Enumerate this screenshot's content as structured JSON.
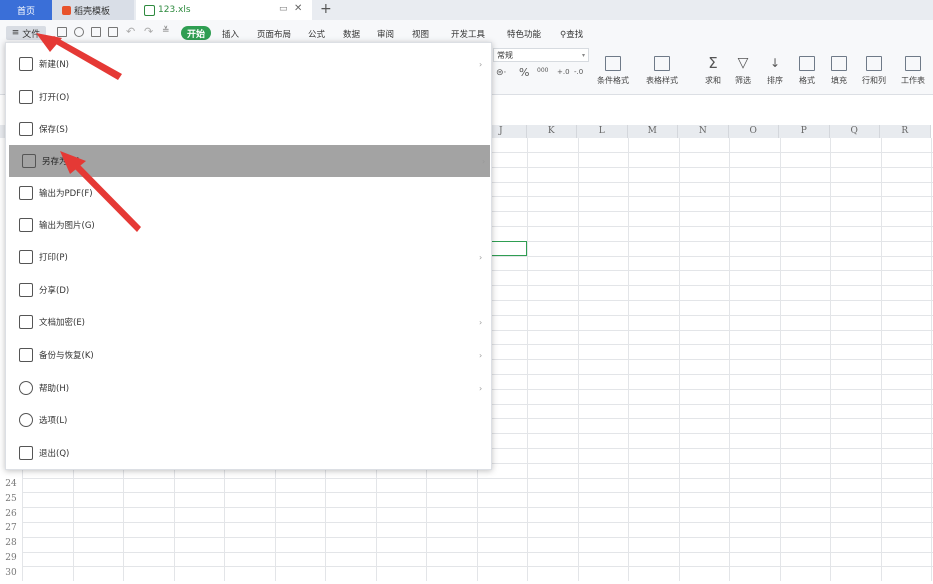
{
  "tabs": {
    "home": "首页",
    "template": "稻壳模板",
    "file": "123.xls"
  },
  "toolbar": {
    "file_menu": "文件",
    "start": "开始",
    "insert": "插入",
    "page_layout": "页面布局",
    "formula": "公式",
    "data": "数据",
    "review": "审阅",
    "view": "视图",
    "dev_tools": "开发工具",
    "special": "特色功能",
    "search": "查找",
    "number_format": "常规",
    "percent_sign": "%",
    "thousands": "000",
    "conditional_format": "条件格式",
    "table_style": "表格样式",
    "sum": "求和",
    "filter": "筛选",
    "sort": "排序",
    "format": "格式",
    "fill": "填充",
    "row_col": "行和列",
    "worksheet": "工作表"
  },
  "grid": {
    "columns": [
      "J",
      "K",
      "L",
      "M",
      "N",
      "O",
      "P",
      "Q",
      "R"
    ],
    "rows": [
      "24",
      "25",
      "26",
      "27",
      "28",
      "29",
      "30"
    ]
  },
  "file_menu": {
    "items": [
      {
        "label": "新建(N)",
        "icon": "new-file-icon",
        "submenu": true
      },
      {
        "label": "打开(O)",
        "icon": "folder-open-icon",
        "submenu": false
      },
      {
        "label": "保存(S)",
        "icon": "save-icon",
        "submenu": false
      },
      {
        "label": "另存为(A)",
        "icon": "save-as-icon",
        "submenu": true,
        "highlighted": true
      },
      {
        "label": "输出为PDF(F)",
        "icon": "pdf-icon",
        "submenu": false
      },
      {
        "label": "输出为图片(G)",
        "icon": "image-icon",
        "submenu": false
      },
      {
        "label": "打印(P)",
        "icon": "print-icon",
        "submenu": true
      },
      {
        "label": "分享(D)",
        "icon": "share-icon",
        "submenu": false
      },
      {
        "label": "文档加密(E)",
        "icon": "encrypt-icon",
        "submenu": true
      },
      {
        "label": "备份与恢复(K)",
        "icon": "backup-icon",
        "submenu": true
      },
      {
        "label": "帮助(H)",
        "icon": "help-icon",
        "submenu": true
      },
      {
        "label": "选项(L)",
        "icon": "settings-icon",
        "submenu": false
      },
      {
        "label": "退出(Q)",
        "icon": "exit-icon",
        "submenu": false
      }
    ]
  },
  "colors": {
    "accent_blue": "#3a6fd8",
    "start_green": "#2f9e52",
    "highlight_gray": "#a3a3a3",
    "annotation_red": "#e53935"
  }
}
